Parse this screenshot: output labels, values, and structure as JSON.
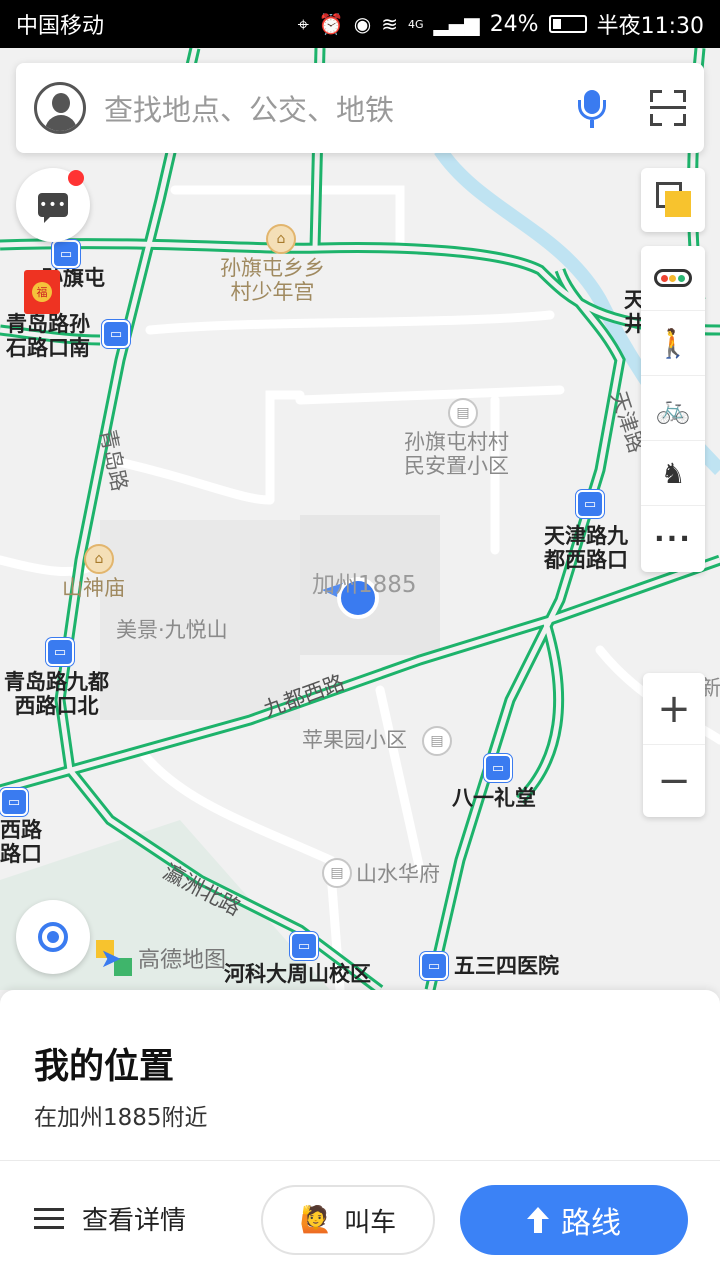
{
  "status_bar": {
    "carrier": "中国移动",
    "network": "4G",
    "battery": "24%",
    "time": "半夜11:30"
  },
  "search": {
    "placeholder": "查找地点、公交、地铁"
  },
  "map": {
    "labels": {
      "sunqitun": "孙旗屯",
      "youth_palace": "孙旗屯乡乡\n村少年宫",
      "qingdao_sunshi": "青岛路孙\n石路口南",
      "qingdao_road": "青岛路",
      "resettle": "孙旗屯村村\n民安置小区",
      "tianjin_road": "天津路",
      "tianjin_jiudu": "天津路九\n都西路口",
      "tianjin_top": "天津\n井",
      "shanshen_temple": "山神庙",
      "meijing": "美景·九悦山",
      "jiazhou": "加州1885",
      "qingdao_jiudu": "青岛路九都\n西路口北",
      "jiudu_west": "九都西路",
      "pingguoyuan": "苹果园小区",
      "bayi": "八一礼堂",
      "xi_road": "西路\n路口",
      "yingzhou": "瀛洲北路",
      "shanshui": "山水华府",
      "heke": "河科大周山校区",
      "wusansi": "五三四医院",
      "xin": "新"
    }
  },
  "tools": {
    "zoom_in": "+",
    "zoom_out": "−",
    "more": "···"
  },
  "brand": {
    "name": "高德地图"
  },
  "panel": {
    "title": "我的位置",
    "subtitle": "在加州1885附近",
    "details_label": "查看详情",
    "taxi_label": "叫车",
    "route_label": "路线"
  },
  "colors": {
    "road_green": "#1db36b",
    "accent_blue": "#3b82f6"
  }
}
